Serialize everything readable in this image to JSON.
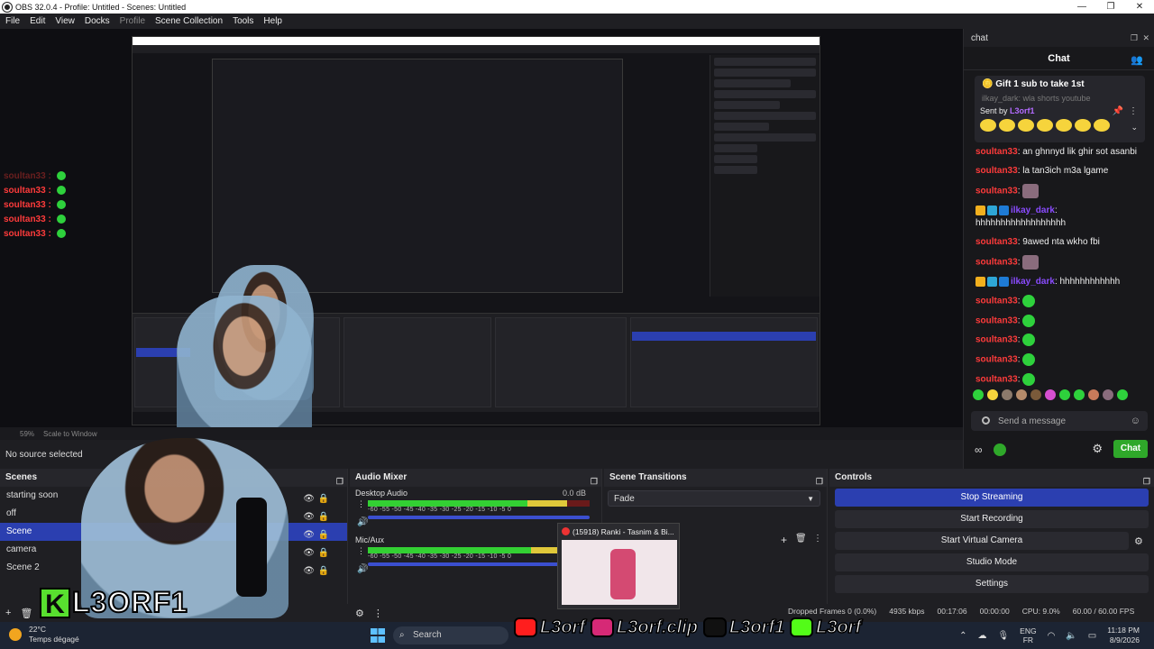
{
  "window": {
    "title": "OBS 32.0.4 - Profile: Untitled - Scenes: Untitled",
    "min_icon": "minimize-icon",
    "max_icon": "maximize-icon",
    "close_icon": "close-icon"
  },
  "menu": [
    "File",
    "Edit",
    "View",
    "Docks",
    "Profile",
    "Scene Collection",
    "Tools",
    "Help"
  ],
  "preview": {
    "left_chat": [
      "soultan33",
      "soultan33",
      "soultan33",
      "soultan33",
      "soultan33"
    ],
    "scale_percent": "59%",
    "scale_mode": "Scale to Window"
  },
  "source_bar": {
    "text": "No source selected"
  },
  "chat_dock": {
    "dock_title": "chat",
    "header": "Chat",
    "pinned_gift": "Gift 1 sub to take 1st",
    "pinned_sent_by": "Sent by",
    "pinned_user": "L3orf1",
    "behind_text": "ilkay_dark: wla shorts youtube",
    "messages": [
      {
        "user": "soultan33",
        "text": "an ghnnyd lik ghir sot asanbi"
      },
      {
        "user": "soultan33",
        "text": "la tan3ich m3a lgame"
      },
      {
        "user": "soultan33",
        "text": ""
      },
      {
        "user": "ilkay_dark",
        "text": "hhhhhhhhhhhhhhhhhh"
      },
      {
        "user": "soultan33",
        "text": "9awed nta wkho fbi"
      },
      {
        "user": "soultan33",
        "text": ""
      },
      {
        "user": "ilkay_dark",
        "text": "hhhhhhhhhhhh"
      },
      {
        "user": "soultan33",
        "text": ""
      },
      {
        "user": "soultan33",
        "text": ""
      },
      {
        "user": "soultan33",
        "text": ""
      },
      {
        "user": "soultan33",
        "text": ""
      },
      {
        "user": "soultan33",
        "text": ""
      }
    ],
    "send_placeholder": "Send a message",
    "chat_button": "Chat"
  },
  "scenes": {
    "title": "Scenes",
    "items": [
      "starting soon",
      "off",
      "Scene",
      "camera",
      "Scene 2"
    ],
    "selected_index": 2
  },
  "audio_mixer": {
    "title": "Audio Mixer",
    "channels": [
      {
        "name": "Desktop Audio",
        "db": "0.0 dB",
        "level": 0.9
      },
      {
        "name": "Mic/Aux",
        "db": "",
        "level": 0.92
      }
    ],
    "ticks": "-60  -55  -50  -45  -40  -35  -30  -25  -20  -15  -10  -5  0"
  },
  "scene_transitions": {
    "title": "Scene Transitions",
    "selected": "Fade",
    "tab_popup": "(15918) Ranki - Tasnim & Bi..."
  },
  "controls": {
    "title": "Controls",
    "buttons": [
      "Stop Streaming",
      "Start Recording",
      "Start Virtual Camera",
      "Studio Mode",
      "Settings"
    ]
  },
  "status_bar": {
    "dropped": "Dropped Frames 0 (0.0%)",
    "kbps": "4935 kbps",
    "stream_time": "00:17:06",
    "rec_time": "00:00:00",
    "cpu": "CPU: 9.0%",
    "fps": "60.00 / 60.00 FPS"
  },
  "overlay": {
    "kick_name": "L3ORF1",
    "socials": [
      {
        "icon": "youtube-icon",
        "handle": "L3orf",
        "color": "#ff1e1e"
      },
      {
        "icon": "instagram-icon",
        "handle": "L3orf.clip",
        "color": "#d62976"
      },
      {
        "icon": "tiktok-icon",
        "handle": "L3orf1",
        "color": "#111111"
      },
      {
        "icon": "kick-icon",
        "handle": "L3orf",
        "color": "#53fc18"
      }
    ]
  },
  "taskbar": {
    "temp": "22°C",
    "weather": "Temps dégagé",
    "search_placeholder": "Search",
    "lang_top": "ENG",
    "lang_bottom": "FR",
    "time": "11:18 PM",
    "date": "8/9/2026"
  },
  "colors": {
    "accent": "#2b3fb0",
    "chat_red": "#ff3b3b",
    "kick_green": "#53fc18",
    "chat_btn": "#2fa82a"
  }
}
